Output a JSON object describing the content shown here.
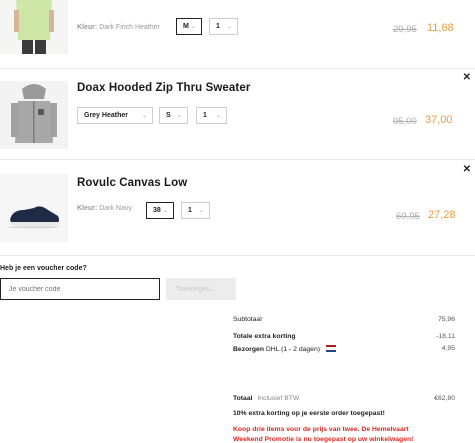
{
  "items": [
    {
      "name": "",
      "color_label": "Kleur:",
      "color_value": "Dark Finch Heather",
      "size": "M",
      "qty": "1",
      "old_price": "29,95",
      "new_price": "11,68",
      "image": "light-green-tshirt"
    },
    {
      "name": "Doax Hooded Zip Thru Sweater",
      "color_select": "Grey Heather",
      "size": "S",
      "qty": "1",
      "old_price": "95,00",
      "new_price": "37,00",
      "image": "grey-hoodie"
    },
    {
      "name": "Rovulc Canvas Low",
      "color_label": "Kleur:",
      "color_value": "Dark Navy",
      "size": "38",
      "qty": "1",
      "old_price": "69,95",
      "new_price": "27,28",
      "image": "navy-sneaker"
    }
  ],
  "icons": {
    "close": "close-icon",
    "chevron": "chevron-down-icon"
  },
  "voucher": {
    "title": "Heb je een voucher code?",
    "placeholder": "Je voucher code",
    "button": "Toevoegen..."
  },
  "summary": {
    "subtotal_label": "Subtotaal",
    "subtotal_value": "75,96",
    "discount_label": "Totale extra korting",
    "discount_value": "-18,11",
    "shipping_label": "Bezorgen",
    "shipping_method": "DHL (1 - 2 dagen)",
    "shipping_value": "4,95",
    "total_label": "Totaal",
    "total_note": "Inclusief BTW",
    "total_value": "€62,80",
    "promo1": "10% extra korting op je eerste order toegepast!",
    "promo2_line1": "Koop drie items voor de prijs van twee. De Hemelvaart",
    "promo2_line2": "Weekend Promotie is nu toegepast op uw winkelwagen!"
  },
  "colors": {
    "accent": "#f39a3c",
    "promo_red": "#e0261b",
    "strike": "#b0b0b0"
  }
}
